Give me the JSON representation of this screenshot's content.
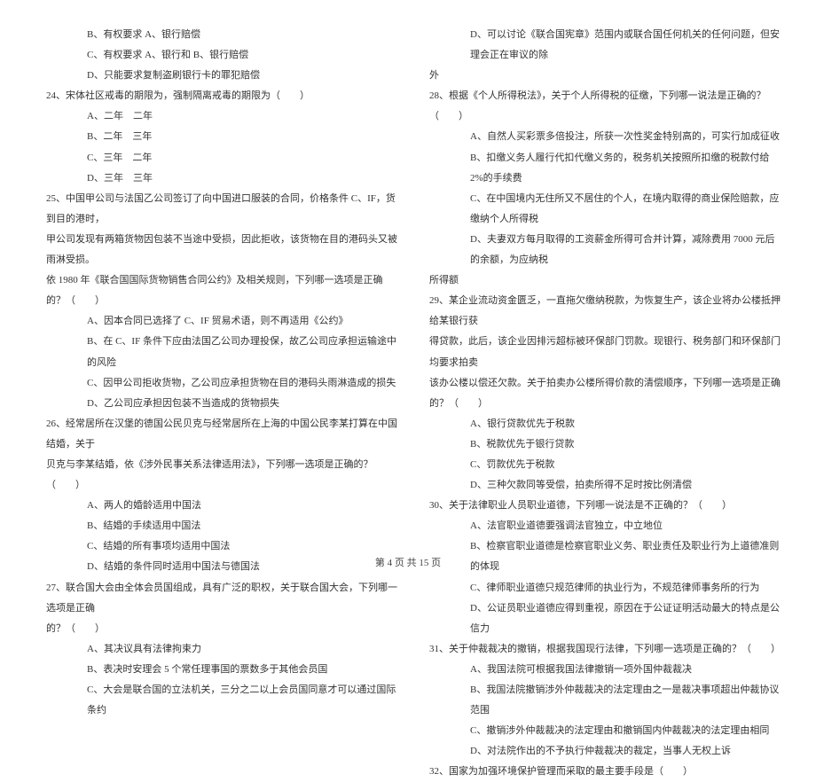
{
  "left": {
    "q23_opts": [
      "B、有权要求 A、银行赔偿",
      "C、有权要求 A、银行和 B、银行赔偿",
      "D、只能要求复制盗刷银行卡的罪犯赔偿"
    ],
    "q24": "24、宋体社区戒毒的期限为，强制隔离戒毒的期限为（　　）",
    "q24_opts": [
      "A、二年　二年",
      "B、二年　三年",
      "C、三年　二年",
      "D、三年　三年"
    ],
    "q25_l1": "25、中国甲公司与法国乙公司签订了向中国进口服装的合同，价格条件 C、IF，货到目的港时，",
    "q25_l2": "甲公司发现有两箱货物因包装不当途中受损，因此拒收，该货物在目的港码头又被雨淋受损。",
    "q25_l3": "依 1980 年《联合国国际货物销售合同公约》及相关规则，下列哪一选项是正确的？（　　）",
    "q25_opts": [
      "A、因本合同已选择了 C、IF 贸易术语，则不再适用《公约》",
      "B、在 C、IF 条件下应由法国乙公司办理投保，故乙公司应承担运输途中的风险",
      "C、因甲公司拒收货物，乙公司应承担货物在目的港码头雨淋造成的损失",
      "D、乙公司应承担因包装不当造成的货物损失"
    ],
    "q26_l1": "26、经常居所在汉堡的德国公民贝克与经常居所在上海的中国公民李某打算在中国结婚，关于",
    "q26_l2": "贝克与李某结婚，依《涉外民事关系法律适用法》，下列哪一选项是正确的？（　　）",
    "q26_opts": [
      "A、两人的婚龄适用中国法",
      "B、结婚的手续适用中国法",
      "C、结婚的所有事项均适用中国法",
      "D、结婚的条件同时适用中国法与德国法"
    ],
    "q27_l1": "27、联合国大会由全体会员国组成，具有广泛的职权，关于联合国大会，下列哪一选项是正确",
    "q27_l2": "的？（　　）",
    "q27_opts": [
      "A、其决议具有法律拘束力",
      "B、表决时安理会 5 个常任理事国的票数多于其他会员国",
      "C、大会是联合国的立法机关，三分之二以上会员国同意才可以通过国际条约"
    ]
  },
  "right": {
    "q27_opt_d_l1": "D、可以讨论《联合国宪章》范围内或联合国任何机关的任何问题，但安理会正在审议的除",
    "q27_opt_d_l2": "外",
    "q28": "28、根据《个人所得税法》，关于个人所得税的征缴，下列哪一说法是正确的？（　　）",
    "q28_opts": [
      "A、自然人买彩票多倍投注，所获一次性奖金特别高的，可实行加成征收",
      "B、扣缴义务人履行代扣代缴义务的，税务机关按照所扣缴的税款付给 2%的手续费",
      "C、在中国境内无住所又不居住的个人，在境内取得的商业保险赔款，应缴纳个人所得税"
    ],
    "q28_opt_d_l1": "D、夫妻双方每月取得的工资薪金所得可合并计算，减除费用 7000 元后的余额，为应纳税",
    "q28_opt_d_l2": "所得额",
    "q29_l1": "29、某企业流动资金匮乏，一直拖欠缴纳税款，为恢复生产，该企业将办公楼抵押给某银行获",
    "q29_l2": "得贷款，此后，该企业因排污超标被环保部门罚款。现银行、税务部门和环保部门均要求拍卖",
    "q29_l3": "该办公楼以偿还欠款。关于拍卖办公楼所得价款的清偿顺序，下列哪一选项是正确的？（　　）",
    "q29_opts": [
      "A、银行贷款优先于税款",
      "B、税款优先于银行贷款",
      "C、罚款优先于税款",
      "D、三种欠款同等受偿，拍卖所得不足时按比例清偿"
    ],
    "q30": "30、关于法律职业人员职业道德，下列哪一说法是不正确的？（　　）",
    "q30_opts": [
      "A、法官职业道德要强调法官独立，中立地位",
      "B、检察官职业道德是检察官职业义务、职业责任及职业行为上道德准则的体现",
      "C、律师职业道德只规范律师的执业行为，不规范律师事务所的行为",
      "D、公证员职业道德应得到重视，原因在于公证证明活动最大的特点是公信力"
    ],
    "q31": "31、关于仲裁裁决的撤销，根据我国现行法律，下列哪一选项是正确的？（　　）",
    "q31_opts": [
      "A、我国法院可根据我国法律撤销一项外国仲裁裁决",
      "B、我国法院撤销涉外仲裁裁决的法定理由之一是裁决事项超出仲裁协议范围",
      "C、撤销涉外仲裁裁决的法定理由和撤销国内仲裁裁决的法定理由相同",
      "D、对法院作出的不予执行仲裁裁决的裁定，当事人无权上诉"
    ],
    "q32": "32、国家为加强环境保护管理而采取的最主要手段是（　　）"
  },
  "footer": "第 4 页  共 15 页"
}
